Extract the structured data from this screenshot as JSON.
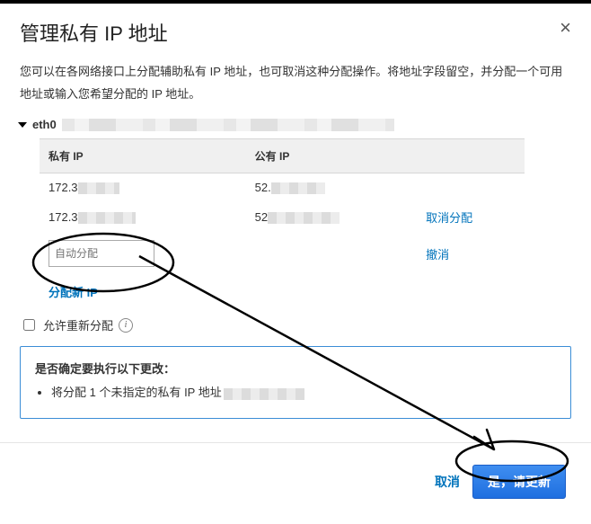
{
  "header": {
    "title": "管理私有 IP 地址"
  },
  "description": "您可以在各网络接口上分配辅助私有 IP 地址，也可取消这种分配操作。将地址字段留空，并分配一个可用地址或输入您希望分配的 IP 地址。",
  "interface": {
    "name": "eth0"
  },
  "table": {
    "headers": {
      "private": "私有 IP",
      "public": "公有 IP",
      "action": ""
    },
    "rows": [
      {
        "private_prefix": "172.3",
        "public_prefix": "52.",
        "action": ""
      },
      {
        "private_prefix": "172.3",
        "public_prefix": "52",
        "action": "取消分配"
      }
    ],
    "input_row": {
      "placeholder": "自动分配",
      "action": "撤消"
    }
  },
  "assign_new": "分配新 IP",
  "reassign": {
    "label": "允许重新分配"
  },
  "confirm": {
    "question": "是否确定要执行以下更改：",
    "item_prefix": "将分配 1 个未指定的私有 IP 地址"
  },
  "footer": {
    "cancel": "取消",
    "ok": "是，请更新"
  }
}
